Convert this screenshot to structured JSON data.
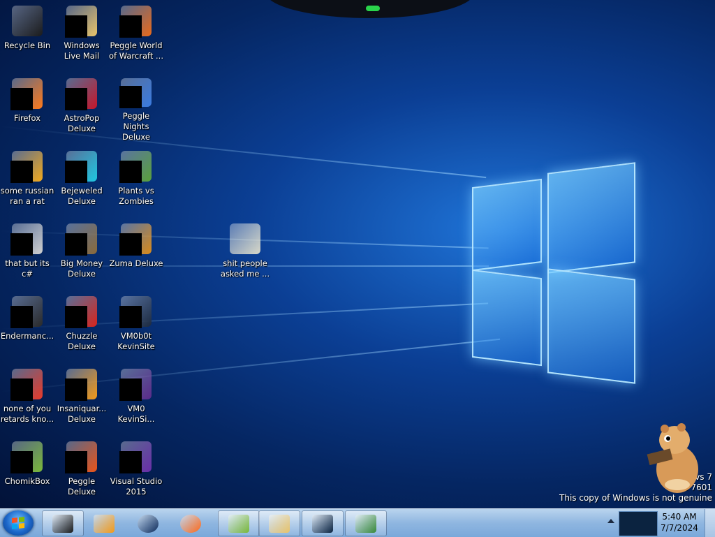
{
  "desktop": {
    "icons": [
      {
        "id": "recycle-bin",
        "label": "Recycle Bin",
        "col": 0,
        "row": 0,
        "art": "#1b1b1b",
        "mask": false
      },
      {
        "id": "windows-live-mail",
        "label": "Windows Live Mail",
        "col": 1,
        "row": 0,
        "art": "#e8c36a",
        "mask": true
      },
      {
        "id": "peggle-world-of-warcraft",
        "label": "Peggle World of Warcraft ...",
        "col": 2,
        "row": 0,
        "art": "#e96a1a",
        "mask": true
      },
      {
        "id": "firefox",
        "label": "Firefox",
        "col": 0,
        "row": 1,
        "art": "#ff7a1a",
        "mask": true
      },
      {
        "id": "astropop-deluxe",
        "label": "AstroPop Deluxe",
        "col": 1,
        "row": 1,
        "art": "#c4162a",
        "mask": true
      },
      {
        "id": "peggle-nights-deluxe",
        "label": "Peggle Nights Deluxe",
        "col": 2,
        "row": 1,
        "art": "#3a7be0",
        "mask": true
      },
      {
        "id": "some-russian-ran-a-rat",
        "label": "some russian ran a rat",
        "col": 0,
        "row": 2,
        "art": "#f2a91c",
        "mask": true
      },
      {
        "id": "bejeweled-deluxe",
        "label": "Bejeweled Deluxe",
        "col": 1,
        "row": 2,
        "art": "#1fc6e0",
        "mask": true
      },
      {
        "id": "plants-vs-zombies",
        "label": "Plants vs Zombies",
        "col": 2,
        "row": 2,
        "art": "#5aa03a",
        "mask": true
      },
      {
        "id": "that-but-its-csharp",
        "label": "that but its c#",
        "col": 0,
        "row": 3,
        "art": "#cfcfcf",
        "mask": true
      },
      {
        "id": "big-money-deluxe",
        "label": "Big Money Deluxe",
        "col": 1,
        "row": 3,
        "art": "#8a6a3a",
        "mask": true
      },
      {
        "id": "zuma-deluxe",
        "label": "Zuma Deluxe",
        "col": 2,
        "row": 3,
        "art": "#d98a1a",
        "mask": true
      },
      {
        "id": "endermanch",
        "label": "Endermanc...",
        "col": 0,
        "row": 4,
        "art": "#2a2a2a",
        "mask": true
      },
      {
        "id": "chuzzle-deluxe",
        "label": "Chuzzle Deluxe",
        "col": 1,
        "row": 4,
        "art": "#d8241c",
        "mask": true
      },
      {
        "id": "vm0b0t-kevinsite",
        "label": "VM0b0t KevinSite",
        "col": 2,
        "row": 4,
        "art": "#1c2a40",
        "mask": true
      },
      {
        "id": "none-of-you",
        "label": "none of you retards kno...",
        "col": 0,
        "row": 5,
        "art": "#e83a2a",
        "mask": true
      },
      {
        "id": "insaniquarium-deluxe",
        "label": "Insaniquar... Deluxe",
        "col": 1,
        "row": 5,
        "art": "#f29a1a",
        "mask": true
      },
      {
        "id": "vm0-kevinsite",
        "label": "VM0 KevinSi...",
        "col": 2,
        "row": 5,
        "art": "#5a2a8a",
        "mask": true
      },
      {
        "id": "chomikbox",
        "label": "ChomikBox",
        "col": 0,
        "row": 6,
        "art": "#7ab83a",
        "mask": true
      },
      {
        "id": "peggle-deluxe",
        "label": "Peggle Deluxe",
        "col": 1,
        "row": 6,
        "art": "#e9541a",
        "mask": true
      },
      {
        "id": "visual-studio-2015",
        "label": "Visual Studio 2015",
        "col": 2,
        "row": 6,
        "art": "#6a2ea8",
        "mask": true
      },
      {
        "id": "folder-shit-people",
        "label": "shit people asked me ...",
        "col": 4,
        "row": 3,
        "art": "#d8d8c8",
        "mask": false
      }
    ]
  },
  "watermark": {
    "line1": "vs 7",
    "line2": "Build 7601",
    "line3": "This copy of Windows is not genuine"
  },
  "taskbar": {
    "start_label": "Start",
    "buttons": [
      {
        "id": "taskbar-app-1",
        "color": "#1a1a1a",
        "pinned": false
      },
      {
        "id": "taskbar-media-player",
        "color": "#f39a1a",
        "pinned": true
      },
      {
        "id": "taskbar-globe",
        "color": "#0d2a5a",
        "pinned": true
      },
      {
        "id": "taskbar-firefox",
        "color": "#ff6a1a",
        "pinned": true
      },
      {
        "id": "taskbar-chomikbox",
        "color": "#7ab83a",
        "pinned": false
      },
      {
        "id": "taskbar-mail",
        "color": "#e8c36a",
        "pinned": false
      },
      {
        "id": "taskbar-vm",
        "color": "#0b2340",
        "pinned": false
      },
      {
        "id": "taskbar-notepad",
        "color": "#3a8a3a",
        "pinned": false
      }
    ],
    "clock": {
      "time": "5:40 AM",
      "date": "7/7/2024"
    }
  }
}
